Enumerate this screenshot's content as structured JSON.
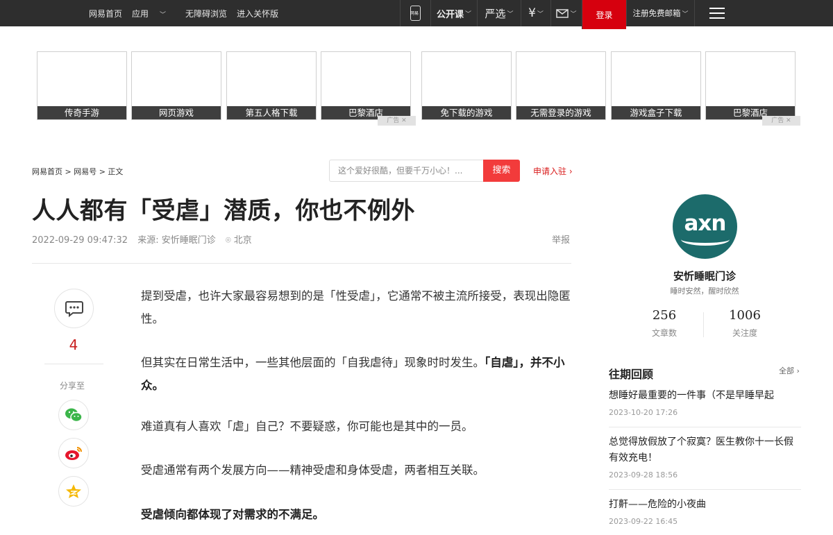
{
  "topnav": {
    "left_links": [
      "网易首页",
      "应用",
      "无障碍浏览",
      "进入关怀版"
    ],
    "app_label": "网易",
    "open_course": "公开课",
    "yanxuan": "严选",
    "currency_symbol": "¥",
    "login": "登录",
    "register": "注册免费邮箱"
  },
  "ads": {
    "tiles": [
      "传奇手游",
      "网页游戏",
      "第五人格下载",
      "巴黎酒店",
      "免下载的游戏",
      "无需登录的游戏",
      "游戏盒子下载",
      "巴黎酒店"
    ],
    "ad_mark": "广告"
  },
  "breadcrumb": "网易首页 > 网易号 > 正文",
  "search": {
    "placeholder": "这个爱好很酷，但要千万小心！...",
    "button": "搜索"
  },
  "apply_link": "申请入驻",
  "article": {
    "title": "人人都有「受虐」潜质，你也不例外",
    "date": "2022-09-29 09:47:32",
    "source": "来源: 安忻睡眠门诊",
    "location": "北京",
    "report": "举报",
    "paragraphs": [
      {
        "text": "提到受虐，也许大家最容易想到的是「性受虐」，它通常不被主流所接受，表现出隐匿性。"
      },
      {
        "text": "但其实在日常生活中，一些其他层面的「自我虐待」现象时时发生。",
        "bold": "「自虐」，并不小众。"
      },
      {
        "text": "难道真有人喜欢「虐」自己？不要疑惑，你可能也是其中的一员。"
      },
      {
        "text": "受虐通常有两个发展方向——精神受虐和身体受虐，两者相互关联。"
      },
      {
        "bold": "受虐倾向都体现了对需求的不满足。"
      }
    ]
  },
  "share": {
    "comment_count": "4",
    "label": "分享至"
  },
  "account": {
    "logo_text": "axn",
    "name": "安忻睡眠门诊",
    "slogan": "睡时安然，醒时欣然",
    "articles_count": "256",
    "articles_label": "文章数",
    "followers_count": "1006",
    "followers_label": "关注度"
  },
  "past": {
    "title": "往期回顾",
    "all": "全部",
    "items": [
      {
        "title": "想睡好最重要的一件事（不是早睡早起",
        "date": "2023-10-20 17:26"
      },
      {
        "title": "总觉得放假放了个寂寞？医生教你十一长假有效充电！",
        "date": "2023-09-28 18:56"
      },
      {
        "title": "打鼾——危险的小夜曲",
        "date": "2023-09-22 16:45"
      }
    ]
  }
}
